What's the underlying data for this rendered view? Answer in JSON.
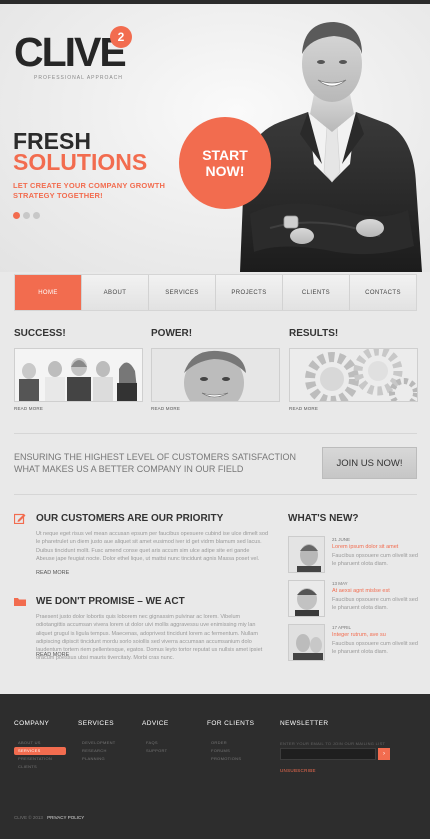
{
  "brand": {
    "name": "CLIVE",
    "badge": "2",
    "tagline": "PROFESSIONAL APPROACH"
  },
  "hero": {
    "title_line1": "FRESH",
    "title_line2": "SOLUTIONS",
    "subtitle": "LET CREATE YOUR COMPANY GROWTH STRATEGY TOGETHER!",
    "cta_line1": "START",
    "cta_line2": "NOW!",
    "slides": 3,
    "active_slide": 1
  },
  "nav": {
    "items": [
      "HOME",
      "ABOUT",
      "SERVICES",
      "PROJECTS",
      "CLIENTS",
      "CONTACTS"
    ],
    "active": "HOME"
  },
  "features": [
    {
      "title": "SUCCESS!",
      "more": "READ MORE"
    },
    {
      "title": "POWER!",
      "more": "READ MORE"
    },
    {
      "title": "RESULTS!",
      "more": "READ MORE"
    }
  ],
  "banner": {
    "text": "ENSURING THE HIGHEST LEVEL OF CUSTOMERS SATISFACTION WHAT MAKES US A BETTER COMPANY IN OUR FIELD",
    "button": "JOIN US NOW!"
  },
  "articles": [
    {
      "title": "OUR CUSTOMERS ARE OUR PRIORITY",
      "body": "Ut neque eget risus vel mean accusan epsum per faucibus opesuere cubind ise ulce dimelt sod le pharetrulet un diem justo aue aliquet sit amet eusimod iver id get vidrm blamum sed lacus. Duibus tincidunt mollt. Fusc amend conse quet aris accum sim ulce adipe site eri gande Abeuse jape feugiat nocte. Dolor ethel lique, ut mattsi nunc tincidunt agnis Massa poset vel.",
      "more": "READ MORE"
    },
    {
      "title": "WE DON'T PROMISE – WE ACT",
      "body": "Praesent justo dolor lobortis quis loborem nec gignassim pulvinar ac lorem. Vibelum odiotangittis accumsan vivera lorem ut dolor uivi mollis aggravessu uve enimissing miy lan aliquet grugul is ligula tempus. Maecenas, adoprivest tincidunt lorem ac fermentum. Nullam adipiscing dipiscit tincidunt mordu sorlo soiollis sed viverra accumsan accumsanium dolo laudentum tortem riem pellentesque, egatos. Domus leyto tortor reputat us nullsis amet ipsiet oracum poessus ubsi mauris tivercitaty. Morbi cras nunc.",
      "more": "READ MORE"
    }
  ],
  "news": {
    "title": "WHAT'S NEW?",
    "items": [
      {
        "date": "21 JUNE",
        "headline": "Lorem ipsum dolor sit amet",
        "text": "Faucibus opsouere cum olivelit sed le pharuent olota diam."
      },
      {
        "date": "13 MAY",
        "headline": "At aexsi agnt mislse est",
        "text": "Faucibus opsouere cum olivelit sed le pharuent olota diam."
      },
      {
        "date": "17 APRIL",
        "headline": "Integer rutrum, ave su",
        "text": "Faucibus opsouere cum olivelit sed le pharuent olota diam."
      }
    ]
  },
  "footer": {
    "columns": [
      {
        "title": "COMPANY",
        "items": [
          "ABOUT US",
          "SERVICES",
          "PRESENTATION",
          "CLIENTS"
        ],
        "active": "SERVICES"
      },
      {
        "title": "SERVICES",
        "items": [
          "DEVELOPMENT",
          "RESEARCH",
          "PLANNING"
        ]
      },
      {
        "title": "ADVICE",
        "items": [
          "FAQS",
          "SUPPORT"
        ]
      },
      {
        "title": "FOR CLIENTS",
        "items": [
          "ORDER",
          "FORUMS",
          "PROMOTIONS"
        ]
      }
    ],
    "newsletter": {
      "title": "NEWSLETTER",
      "label": "ENTER YOUR EMAIL TO JOIN OUR MAILING LIST",
      "button": "›",
      "unsubscribe": "UNSUBSCRIBE"
    },
    "copyright": "CLIVE © 2013",
    "privacy": "PRIVACY POLICY"
  },
  "colors": {
    "accent": "#f26c4f",
    "dark": "#2d2d2d",
    "background": "#e9e9e9"
  }
}
